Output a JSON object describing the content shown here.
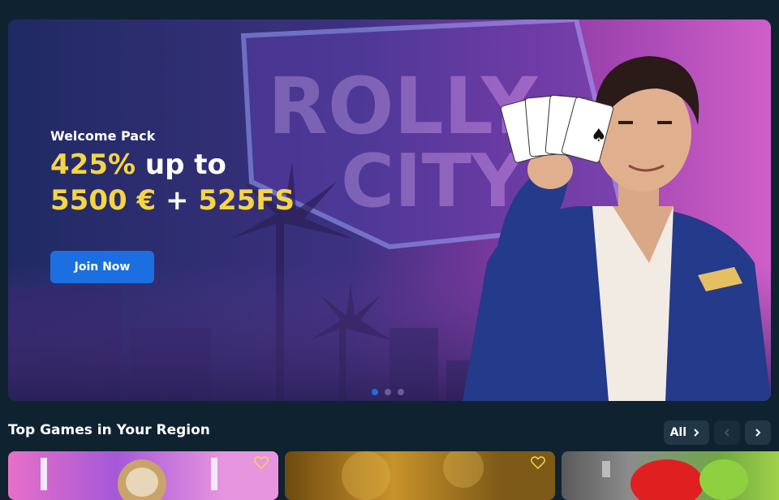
{
  "hero": {
    "kicker": "Welcome Pack",
    "line1_highlight": "425%",
    "line1_rest": " up to",
    "line2_amount": "5500 €",
    "line2_plus": " + ",
    "line2_fs": "525FS",
    "join_label": "Join Now",
    "sign_text": "ROLLY CITY",
    "slides": 3,
    "active_slide": 0
  },
  "games_section": {
    "title": "Top Games in Your Region",
    "all_label": "All"
  },
  "colors": {
    "accent": "#1b6fe0",
    "highlight": "#f7d542",
    "background": "#0f2230"
  },
  "icons": {
    "chevron_right": "chevron-right-icon",
    "chevron_left": "chevron-left-icon",
    "heart": "heart-icon"
  }
}
